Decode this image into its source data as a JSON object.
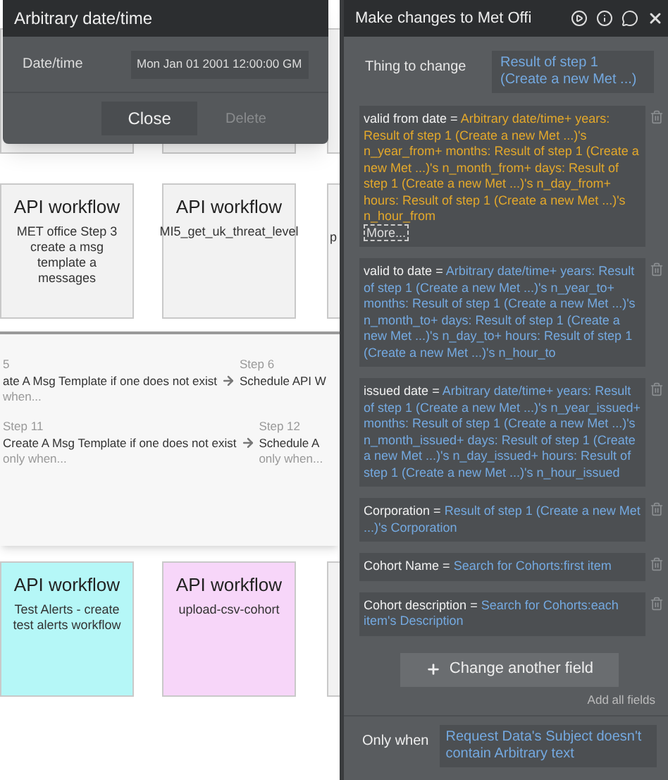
{
  "popup": {
    "title": "Arbitrary date/time",
    "field_label": "Date/time",
    "field_value": "Mon Jan 01 2001 12:00:00 GM",
    "buttons": [
      {
        "label": "Close",
        "disabled": false
      },
      {
        "label": "Delete",
        "disabled": true
      }
    ]
  },
  "top_cards": [
    {
      "title": "API workflow",
      "description": "MET office Step 3 create a msg template a messages"
    },
    {
      "title": "API workflow",
      "description": "MI5_get_uk_threat_level"
    },
    {
      "description": "p"
    }
  ],
  "step_rows": [
    {
      "steps": [
        {
          "number": "5",
          "name": "ate A Msg Template if one does not exist",
          "condition": "when..."
        },
        {
          "number": "Step 6",
          "name": "Schedule API W"
        }
      ]
    },
    {
      "steps": [
        {
          "number": "Step 11",
          "name": "Create A Msg Template if one does not exist",
          "condition": "only when..."
        },
        {
          "number": "Step 12",
          "name": "Schedule A",
          "condition": "only when..."
        }
      ]
    }
  ],
  "bottom_cards": [
    {
      "title": "API workflow",
      "description": "Test Alerts - create test alerts workflow",
      "color": "#b5f7f7"
    },
    {
      "title": "API workflow",
      "description": "upload-csv-cohort",
      "color": "#f7d6f9"
    },
    {
      "color": "#f2f2f2"
    }
  ],
  "panel": {
    "title": "Make changes to Met Offi",
    "thing_label": "Thing to change",
    "thing_value": "Result of step 1 (Create a new Met ...)",
    "changes": [
      {
        "field": "valid from date",
        "value": "Arbitrary date/time+ years: Result of step 1 (Create a new Met ...)'s n_year_from+ months: Result of step 1 (Create a new Met ...)'s n_month_from+ days: Result of step 1 (Create a new Met ...)'s n_day_from+ hours: Result of step 1 (Create a new Met ...)'s n_hour_from",
        "color": "#e3a82b",
        "more": "More..."
      },
      {
        "field": "valid to date",
        "value": "Arbitrary date/time+ years: Result of step 1 (Create a new Met ...)'s n_year_to+ months: Result of step 1 (Create a new Met ...)'s n_month_to+ days: Result of step 1 (Create a new Met ...)'s n_day_to+ hours: Result of step 1 (Create a new Met ...)'s n_hour_to",
        "color": "#74a9e0"
      },
      {
        "field": "issued date",
        "value": "Arbitrary date/time+ years: Result of step 1 (Create a new Met ...)'s n_year_issued+ months: Result of step 1 (Create a new Met ...)'s n_month_issued+ days: Result of step 1 (Create a new Met ...)'s n_day_issued+ hours: Result of step 1 (Create a new Met ...)'s n_hour_issued",
        "color": "#74a9e0"
      },
      {
        "field": "Corporation",
        "value": "Result of step 1 (Create a new Met ...)'s Corporation",
        "color": "#74a9e0"
      },
      {
        "field": "Cohort Name",
        "value": "Search for Cohorts:first item",
        "color": "#74a9e0"
      },
      {
        "field": "Cohort description",
        "value": "Search for Cohorts:each item's Description",
        "color": "#74a9e0"
      }
    ],
    "equals": "=",
    "add_button": "Change another field",
    "add_all": "Add all fields",
    "only_when_label": "Only when",
    "only_when_value": "Request Data's Subject doesn't contain Arbitrary text"
  }
}
